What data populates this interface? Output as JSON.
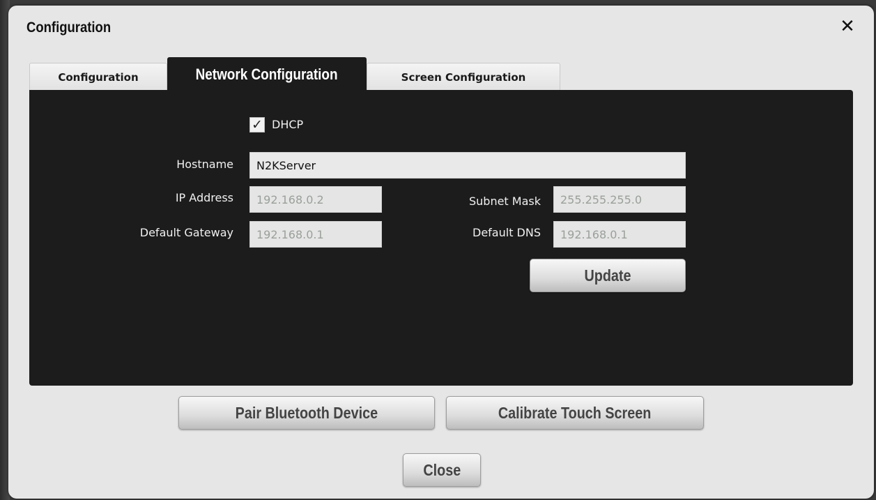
{
  "dialog": {
    "title": "Configuration",
    "close_icon": "close-icon"
  },
  "tabs": [
    {
      "label": "Configuration",
      "active": false
    },
    {
      "label": "Network Configuration",
      "active": true
    },
    {
      "label": "Screen Configuration",
      "active": false
    }
  ],
  "network": {
    "dhcp": {
      "label": "DHCP",
      "checked": true,
      "check_glyph": "✓"
    },
    "hostname": {
      "label": "Hostname",
      "value": "N2KServer"
    },
    "ip_address": {
      "label": "IP Address",
      "value": "192.168.0.2"
    },
    "subnet_mask": {
      "label": "Subnet Mask",
      "value": "255.255.255.0"
    },
    "default_gateway": {
      "label": "Default Gateway",
      "value": "192.168.0.1"
    },
    "default_dns": {
      "label": "Default DNS",
      "value": "192.168.0.1"
    },
    "update_label": "Update"
  },
  "footer": {
    "pair_bluetooth_label": "Pair Bluetooth Device",
    "calibrate_label": "Calibrate Touch Screen",
    "close_label": "Close"
  },
  "colors": {
    "panel_bg": "#1c1c1c",
    "dialog_bg": "#e6e6e6",
    "disabled_text": "#9aa09a"
  }
}
